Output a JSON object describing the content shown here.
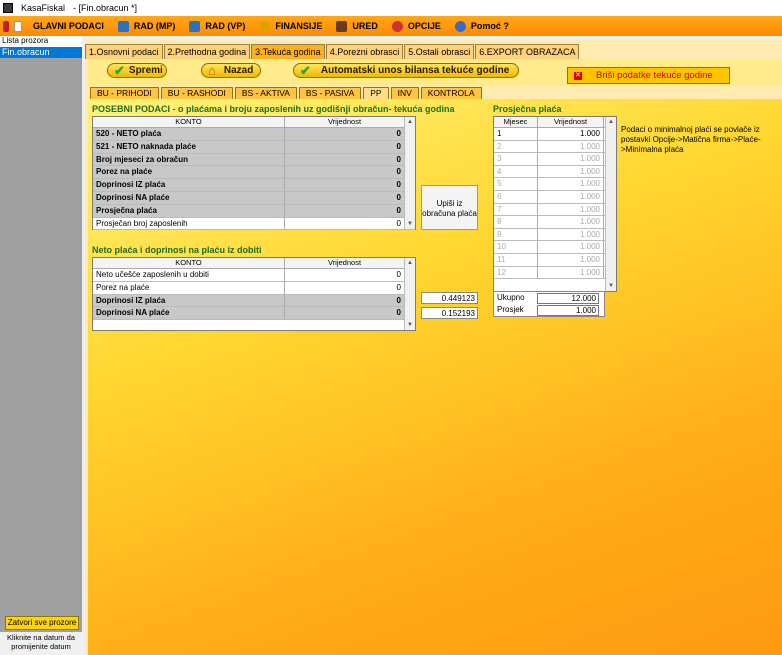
{
  "window": {
    "app": "KasaFiskal",
    "doc": "- [Fin.obracun *]"
  },
  "menu": [
    {
      "label": "GLAVNI PODACI",
      "color": "#2d6fc0"
    },
    {
      "label": "RAD (MP)",
      "color": "#2d6fc0"
    },
    {
      "label": "RAD (VP)",
      "color": "#2d6fc0"
    },
    {
      "label": "FINANSIJE",
      "color": "#e0a000"
    },
    {
      "label": "URED",
      "color": "#6a3a1a"
    },
    {
      "label": "OPCIJE",
      "color": "#d03030"
    },
    {
      "label": "Pomoć ?",
      "color": "#3a6ac8"
    }
  ],
  "left": {
    "header": "Lista prozora",
    "item": "Fin.obracun",
    "close_all": "Zatvori sve prozore",
    "info": "Kliknite na datum da promijenite datum"
  },
  "tabs": [
    "1.Osnovni podaci",
    "2.Prethodna godina",
    "3.Tekuća godina",
    "4.Porezni obrasci",
    "5.Ostali obrasci",
    "6.EXPORT OBRAZACA"
  ],
  "toolbar": {
    "save": "Spremi",
    "back": "Nazad",
    "auto": "Automatski unos bilansa tekuće godine",
    "delete": "Briši podatke tekuće godine"
  },
  "subtabs": [
    "BU - PRIHODI",
    "BU - RASHODI",
    "BS - AKTIVA",
    "BS - PASIVA",
    "PP",
    "INV",
    "KONTROLA"
  ],
  "special": {
    "title": "POSEBNI PODACI - o plaćama i broju zaposlenih uz godišnji obračun- tekuća godina",
    "col_konto": "KONTO",
    "col_value": "Vrijednost",
    "rows": [
      {
        "label": "520 - NETO plaća",
        "value": "0"
      },
      {
        "label": "521 - NETO naknada plaće",
        "value": "0"
      },
      {
        "label": "Broj mjeseci za obračun",
        "value": "0"
      },
      {
        "label": "Porez na plaće",
        "value": "0"
      },
      {
        "label": "Doprinosi IZ plaća",
        "value": "0"
      },
      {
        "label": "Doprinosi NA plaće",
        "value": "0"
      },
      {
        "label": "Prosječna plaća",
        "value": "0"
      },
      {
        "label": "Prosječan broj zaposlenih",
        "value": "0"
      }
    ]
  },
  "calc_button": "Upiši iz obračuna plaća",
  "profit": {
    "title": "Neto plaća i doprinosi na plaću iz dobiti",
    "col_konto": "KONTO",
    "col_value": "Vrijednost",
    "rows": [
      {
        "label": "Neto učešće zaposlenih u dobiti",
        "value": "0"
      },
      {
        "label": "Porez na plaće",
        "value": "0"
      },
      {
        "label": "Doprinosi IZ plaća",
        "value": "0"
      },
      {
        "label": "Doprinosi NA plaće",
        "value": "0"
      }
    ],
    "factor1": "0.449123",
    "factor2": "0.152193"
  },
  "avg": {
    "title": "Prosječna plaća",
    "col_month": "Mjesec",
    "col_value": "Vrijednost",
    "months": [
      {
        "m": "1",
        "v": "1.000"
      },
      {
        "m": "2",
        "v": "1.000"
      },
      {
        "m": "3",
        "v": "1.000"
      },
      {
        "m": "4",
        "v": "1.000"
      },
      {
        "m": "5",
        "v": "1.000"
      },
      {
        "m": "6",
        "v": "1.000"
      },
      {
        "m": "7",
        "v": "1.000"
      },
      {
        "m": "8",
        "v": "1.000"
      },
      {
        "m": "9",
        "v": "1.000"
      },
      {
        "m": "10",
        "v": "1.000"
      },
      {
        "m": "11",
        "v": "1.000"
      },
      {
        "m": "12",
        "v": "1.000"
      }
    ],
    "total_label": "Ukupno",
    "total": "12.000",
    "avg_label": "Prosjek",
    "avg": "1.000"
  },
  "note": "Podaci o minimalnoj plaći se povlače iz postavki Opcije->Matična firma->Plaće->Minimalna plaća"
}
